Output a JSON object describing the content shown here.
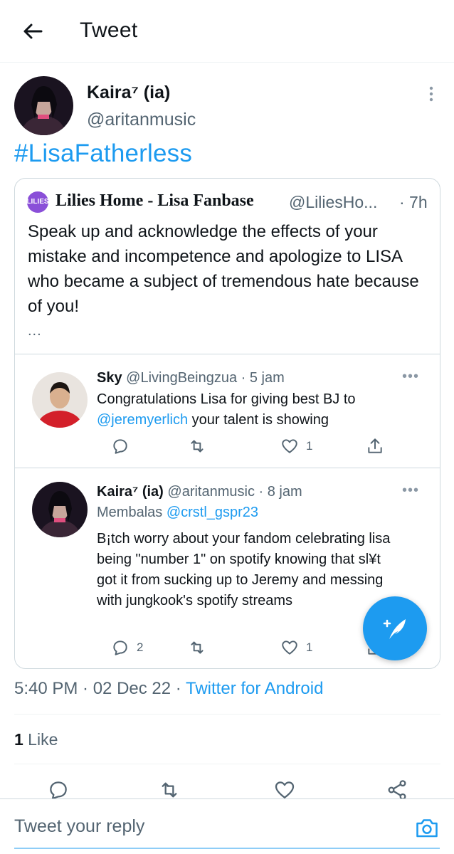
{
  "header": {
    "title": "Tweet"
  },
  "tweet": {
    "author_name": "Kaira⁷ (ia)",
    "author_handle": "@aritanmusic",
    "text": "#LisaFatherless",
    "timestamp": "5:40 PM · 02 Dec 22 · ",
    "client": "Twitter for Android",
    "like_count": "1",
    "like_label": " Like"
  },
  "quote": {
    "logo_text": "LILIES",
    "name": "Lilies Home - Lisa Fanbase",
    "handle": "@LiliesHo...",
    "time": "· 7h",
    "text": "Speak up and acknowledge the effects of your mistake and incompetence and apologize to LISA who became a subject of tremendous hate because of you!",
    "ellipsis": "..."
  },
  "replies": [
    {
      "name": "Sky",
      "handle": " @LivingBeingzua · 5 jam",
      "text_before": "Congratulations Lisa for giving best BJ to ",
      "mention": "@jeremyerlich",
      "text_after": " your talent is showing",
      "comments": "",
      "retweets": "",
      "likes": "1"
    },
    {
      "name": "Kaira⁷ (ia)",
      "handle": " @aritanmusic · 8 jam",
      "reply_prefix": "Membalas ",
      "reply_to": "@crstl_gspr23",
      "text": "B¡tch worry about your fandom celebrating lisa being \"number 1\" on spotify knowing that sl¥t got it from sucking up to Jeremy and messing with jungkook's spotify streams",
      "comments": "2",
      "retweets": "",
      "likes": "1"
    }
  ],
  "reply_bar": {
    "placeholder": "Tweet your reply"
  },
  "icons": {
    "back": "arrow-left-icon",
    "more": "more-vertical-icon",
    "compose": "compose-feather-icon",
    "camera": "camera-icon"
  },
  "colors": {
    "accent": "#1d9bf0",
    "text": "#0f1419",
    "secondary": "#536471",
    "border": "#cfd9de",
    "logo": "#8a4fd8"
  }
}
